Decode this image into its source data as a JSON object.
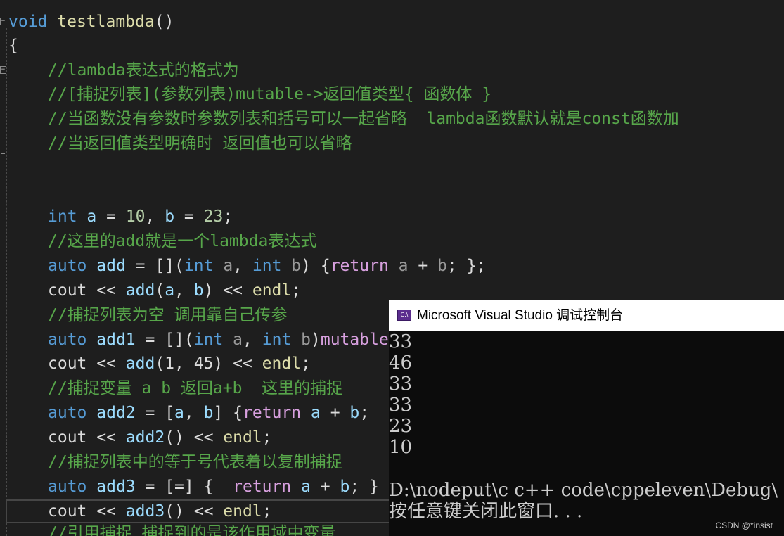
{
  "code": {
    "signature": {
      "return_type": "void",
      "name": "testlambda",
      "parens": "()"
    },
    "open_brace": "{",
    "comments": [
      "//lambda表达式的格式为",
      "//[捕捉列表](参数列表)mutable->返回值类型{ 函数体 }",
      "//当函数没有参数时参数列表和括号可以一起省略  lambda函数默认就是const函数加",
      "//当返回值类型明确时 返回值也可以省略"
    ],
    "decl": {
      "type": "int",
      "a": "a",
      "eq1": " = ",
      "v1": "10",
      "sep": ", ",
      "b": "b",
      "eq2": " = ",
      "v2": "23",
      "end": ";"
    },
    "c_add": "//这里的add就是一个lambda表达式",
    "add_def": {
      "auto": "auto",
      "name": "add",
      "eq": " = ",
      "capture": "[]",
      "lp": "(",
      "t1": "int",
      "p1": "a",
      "comma": ", ",
      "t2": "int",
      "p2": "b",
      "rp": ") ",
      "lb": "{",
      "ret": "return",
      "expr_a": "a",
      "op": " + ",
      "expr_b": "b",
      "tail": "; };"
    },
    "cout1": {
      "cout": "cout",
      "shl1": " << ",
      "fn": "add",
      "args_open": "(",
      "a": "a",
      "comma": ", ",
      "b": "b",
      "args_close": ")",
      "shl2": " << ",
      "endl": "endl",
      "semi": ";"
    },
    "c_add1": "//捕捉列表为空 调用靠自己传参",
    "add1_def": {
      "auto": "auto",
      "name": "add1",
      "eq": " = ",
      "capture": "[]",
      "lp": "(",
      "t1": "int",
      "p1": "a",
      "comma": ", ",
      "t2": "int",
      "p2": "b",
      "rp": ")",
      "mut": "mutable"
    },
    "cout2": {
      "cout": "cout",
      "shl1": " << ",
      "fn": "add",
      "args": "(1, 45)",
      "shl2": " << ",
      "endl": "endl",
      "semi": ";"
    },
    "c_add2": "//捕捉变量 a b 返回a+b  这里的捕捉",
    "add2_def": {
      "auto": "auto",
      "name": "add2",
      "eq": " = ",
      "lb": "[",
      "a": "a",
      "comma": ", ",
      "b": "b",
      "rb": "] ",
      "ob": "{",
      "ret": "return",
      "expr_a": "a",
      "op": " + ",
      "expr_b": "b",
      "tail": ";"
    },
    "cout3": {
      "cout": "cout",
      "shl1": " << ",
      "fn": "add2",
      "call": "()",
      "shl2": " << ",
      "endl": "endl",
      "semi": ";"
    },
    "c_add3": "//捕捉列表中的等于号代表着以复制捕捉",
    "add3_def": {
      "auto": "auto",
      "name": "add3",
      "eq": " = ",
      "capture": "[=]",
      "ob": " {  ",
      "ret": "return",
      "expr_a": "a",
      "op": " + ",
      "expr_b": "b",
      "tail": "; }"
    },
    "cout4": {
      "cout": "cout",
      "shl1": " << ",
      "fn": "add3",
      "call": "()",
      "shl2": " << ",
      "endl": "endl",
      "semi": ";"
    },
    "c_ref": "//引用捕捉 捕捉到的是该作用域中变量"
  },
  "console": {
    "title": "Microsoft Visual Studio 调试控制台",
    "icon_text": "C:\\",
    "output": [
      "33",
      "46",
      "33",
      "33",
      "23",
      "10"
    ],
    "path_line": "D:\\nodeput\\c c++ code\\cppeleven\\Debug\\",
    "prompt": "按任意键关闭此窗口. . ."
  },
  "watermark": "CSDN @*insist",
  "colors": {
    "keyword": "#569cd6",
    "comment": "#57a64a",
    "function": "#dcdcaa",
    "variable": "#9cdcfe",
    "number": "#b5cea8",
    "control": "#d8a0df",
    "background": "#1e1e1e",
    "console_bg": "#0c0c0c"
  }
}
